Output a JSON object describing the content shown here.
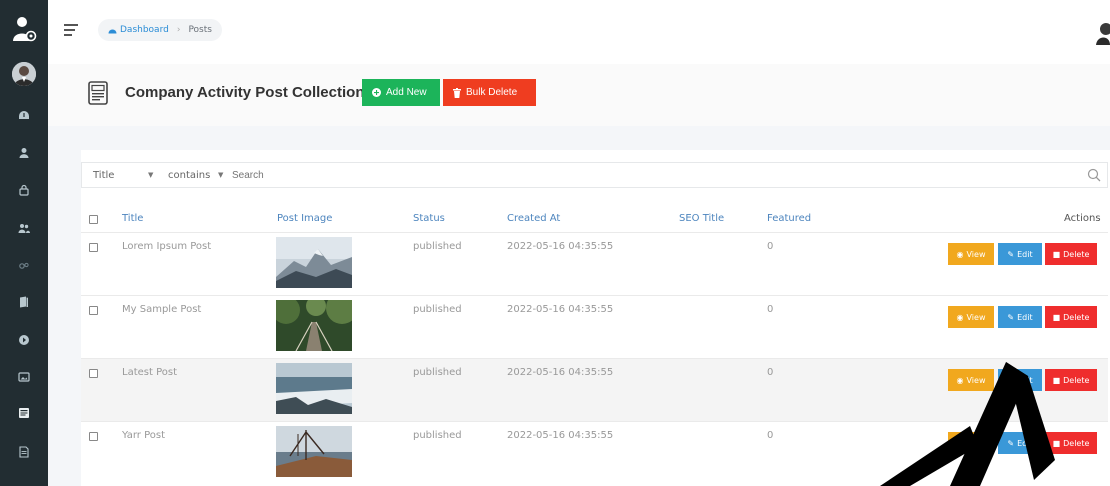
{
  "breadcrumb": {
    "home": "Dashboard",
    "current": "Posts"
  },
  "page": {
    "title": "Company Activity Post Collection",
    "add_label": "Add New",
    "bulk_delete_label": "Bulk Delete"
  },
  "filter": {
    "column": "Title",
    "operator": "contains",
    "search_placeholder": "Search"
  },
  "table": {
    "headers": {
      "title": "Title",
      "image": "Post Image",
      "status": "Status",
      "created": "Created At",
      "seo": "SEO Title",
      "featured": "Featured",
      "actions": "Actions"
    },
    "rows": [
      {
        "title": "Lorem Ipsum Post",
        "status": "published",
        "created": "2022-05-16 04:35:55",
        "seo": "",
        "featured": "0",
        "image": "mountain"
      },
      {
        "title": "My Sample Post",
        "status": "published",
        "created": "2022-05-16 04:35:55",
        "seo": "",
        "featured": "0",
        "image": "forest-bridge"
      },
      {
        "title": "Latest Post",
        "status": "published",
        "created": "2022-05-16 04:35:55",
        "seo": "",
        "featured": "0",
        "image": "coast-waves"
      },
      {
        "title": "Yarr Post",
        "status": "published",
        "created": "2022-05-16 04:35:55",
        "seo": "",
        "featured": "0",
        "image": "sailboat"
      }
    ],
    "actions": {
      "view": "View",
      "edit": "Edit",
      "delete": "Delete"
    }
  },
  "colors": {
    "sidebar": "#222d32",
    "add": "#1cb45a",
    "bulk_delete": "#ef3d20",
    "view": "#f1a81e",
    "edit": "#3a98d8",
    "delete": "#ef2d2d",
    "header_text": "#4d85be"
  },
  "icons": [
    "app-logo-icon",
    "user-avatar",
    "dashboard-icon",
    "user-icon",
    "lock-icon",
    "users-icon",
    "settings-icon",
    "book-icon",
    "circle-icon",
    "image-icon",
    "posts-icon",
    "page-icon",
    "menu-icon",
    "home-icon",
    "document-icon",
    "plus-icon",
    "trash-icon",
    "search-icon",
    "eye-icon",
    "edit-icon"
  ]
}
